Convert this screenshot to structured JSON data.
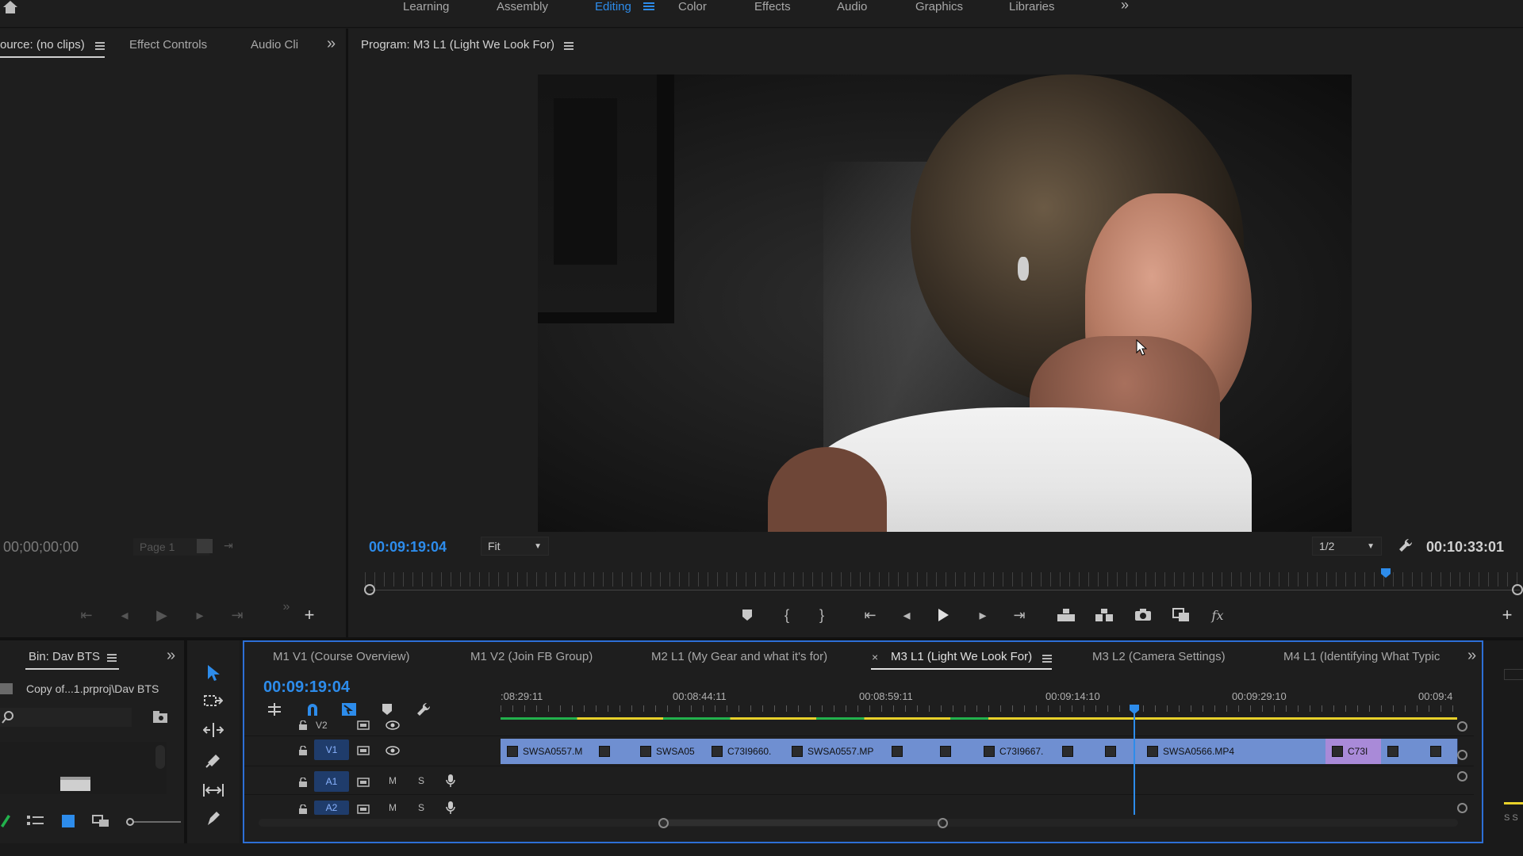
{
  "workspace_tabs": [
    {
      "label": "Learning"
    },
    {
      "label": "Assembly"
    },
    {
      "label": "Editing",
      "active": true
    },
    {
      "label": "Color"
    },
    {
      "label": "Effects"
    },
    {
      "label": "Audio"
    },
    {
      "label": "Graphics"
    },
    {
      "label": "Libraries"
    }
  ],
  "source_panel": {
    "tabs": [
      "ource: (no clips)",
      "Effect Controls",
      "Audio Cli"
    ],
    "timecode": "00;00;00;00",
    "page": "Page 1"
  },
  "program_monitor": {
    "title": "Program: M3 L1 (Light We Look For)",
    "current_time": "00:09:19:04",
    "zoom": "Fit",
    "resolution": "1/2",
    "duration": "00:10:33:01"
  },
  "bin": {
    "title": "Bin: Dav BTS",
    "path": "Copy of...1.prproj\\Dav BTS"
  },
  "timeline": {
    "current_time": "00:09:19:04",
    "sequence_tabs": [
      {
        "label": "M1 V1 (Course Overview)"
      },
      {
        "label": "M1 V2 (Join FB Group)"
      },
      {
        "label": "M2 L1 (My Gear and what it's for)"
      },
      {
        "label": "M3 L1 (Light We Look For)",
        "active": true
      },
      {
        "label": "M3 L2 (Camera Settings)"
      },
      {
        "label": "M4 L1 (Identifying What Typic"
      }
    ],
    "ruler_labels": [
      ":08:29:11",
      "00:08:44:11",
      "00:08:59:11",
      "00:09:14:10",
      "00:09:29:10",
      "00:09:4"
    ],
    "tracks": {
      "v2": "V2",
      "v1": "V1",
      "a1": "A1",
      "a2": "A2",
      "mute": "M",
      "solo": "S"
    },
    "clips": [
      {
        "name": "SWSA0557.M",
        "color": "#6f8fd1"
      },
      {
        "name": "",
        "color": "#6f8fd1"
      },
      {
        "name": "SWSA05",
        "color": "#6f8fd1"
      },
      {
        "name": "C73I9660.",
        "color": "#6f8fd1"
      },
      {
        "name": "SWSA0557.MP",
        "color": "#6f8fd1"
      },
      {
        "name": "",
        "color": "#6f8fd1"
      },
      {
        "name": "",
        "color": "#6f8fd1"
      },
      {
        "name": "C73I9667.",
        "color": "#6f8fd1"
      },
      {
        "name": "",
        "color": "#6f8fd1"
      },
      {
        "name": "",
        "color": "#6f8fd1"
      },
      {
        "name": "SWSA0566.MP4",
        "color": "#6f8fd1"
      },
      {
        "name": "",
        "color": "#6f8fd1"
      },
      {
        "name": "C73I",
        "color": "#a98ad8"
      },
      {
        "name": "",
        "color": "#6f8fd1"
      },
      {
        "name": "",
        "color": "#6f8fd1"
      }
    ]
  },
  "right_edge": {
    "solo_label": "S S"
  },
  "colors": {
    "accent": "#2d8ceb",
    "clip_blue": "#6f8fd1",
    "clip_purple": "#a98ad8",
    "render_green": "#22b14c",
    "render_yellow": "#e8d12a"
  }
}
